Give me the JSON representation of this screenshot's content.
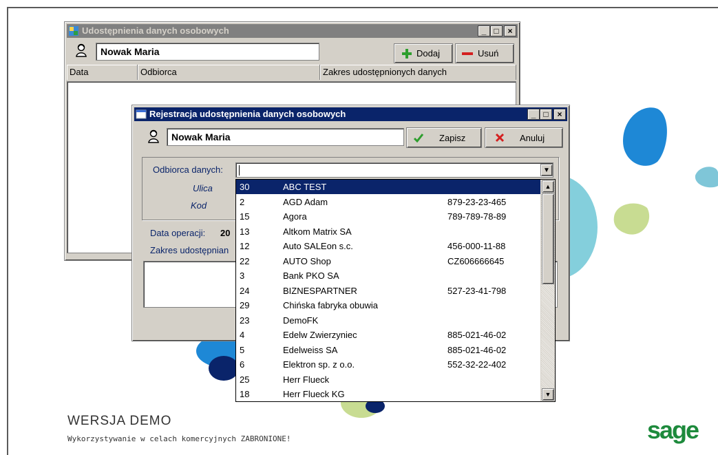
{
  "main_window": {
    "title": "Udostępnienia danych osobowych",
    "person_name": "Nowak Maria",
    "add_label": "Dodaj",
    "remove_label": "Usuń",
    "columns": [
      "Data",
      "Odbiorca",
      "Zakres udostępnionych danych"
    ]
  },
  "dialog": {
    "title": "Rejestracja udostępnienia danych osobowych",
    "person_name": "Nowak Maria",
    "save_label": "Zapisz",
    "cancel_label": "Anuluj",
    "recipient_label": "Odbiorca danych:",
    "recipient_value": "",
    "street_label": "Ulica",
    "code_label": "Kod",
    "date_label": "Data operacji:",
    "date_value_partial": "20",
    "scope_label_partial": "Zakres udostępnian"
  },
  "recipients": [
    {
      "id": "30",
      "name": "ABC TEST",
      "nip": "",
      "selected": true
    },
    {
      "id": "2",
      "name": "AGD Adam",
      "nip": "879-23-23-465"
    },
    {
      "id": "15",
      "name": "Agora",
      "nip": "789-789-78-89"
    },
    {
      "id": "13",
      "name": "Altkom Matrix SA",
      "nip": ""
    },
    {
      "id": "12",
      "name": "Auto SALEon s.c.",
      "nip": "456-000-11-88"
    },
    {
      "id": "22",
      "name": "AUTO Shop",
      "nip": "CZ606666645"
    },
    {
      "id": "3",
      "name": "Bank PKO SA",
      "nip": ""
    },
    {
      "id": "24",
      "name": "BIZNESPARTNER",
      "nip": "527-23-41-798"
    },
    {
      "id": "29",
      "name": "Chińska fabryka obuwia",
      "nip": ""
    },
    {
      "id": "23",
      "name": "DemoFK",
      "nip": ""
    },
    {
      "id": "4",
      "name": "Edelw Zwierzyniec",
      "nip": "885-021-46-02"
    },
    {
      "id": "5",
      "name": "Edelweiss SA",
      "nip": "885-021-46-02"
    },
    {
      "id": "6",
      "name": "Elektron sp. z o.o.",
      "nip": "552-32-22-402"
    },
    {
      "id": "25",
      "name": "Herr Flueck",
      "nip": ""
    },
    {
      "id": "18",
      "name": "Herr Flueck KG",
      "nip": ""
    }
  ],
  "footer": {
    "demo_title": "WERSJA DEMO",
    "demo_note": "Wykorzystywanie w celach komercyjnych ZABRONIONE!",
    "brand": "sage"
  },
  "colors": {
    "active_title": "#0a246a",
    "inactive_title": "#808080",
    "brand_green": "#1d8a3c",
    "deco_blue": "#1e88d6",
    "deco_teal": "#5bbfd0",
    "deco_lime": "#c8dc92"
  }
}
